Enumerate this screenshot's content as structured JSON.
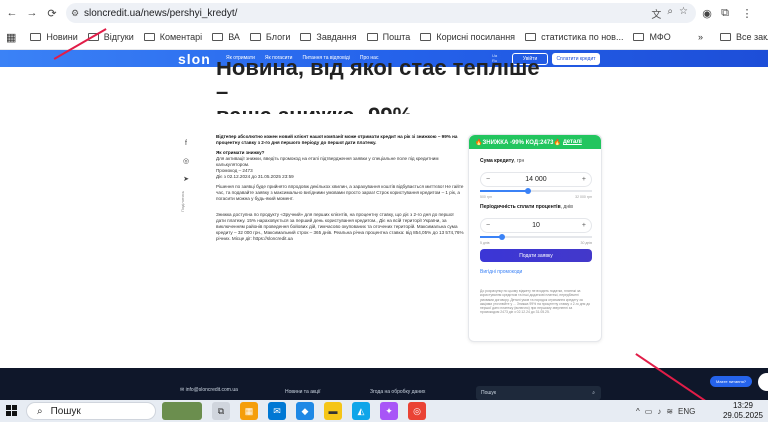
{
  "browser": {
    "url": "sloncredit.ua/news/pershyi_kredyt/",
    "bookmarks": [
      "Новини",
      "Відгуки",
      "Коментарі",
      "ВА",
      "Блоги",
      "Завдання",
      "Пошта",
      "Корисні посилання",
      "статистика по нов...",
      "МФО"
    ],
    "all_bookmarks": "Все закладки",
    "overflow": "»"
  },
  "site": {
    "logo": "slon",
    "nav": [
      "Як отримати",
      "Як погасити",
      "Питання та відповіді",
      "Про нас"
    ],
    "lang": "Ua\nRu",
    "login": "Увійти",
    "pay": "Сплатити кредит"
  },
  "article": {
    "title_line1": "Новина, від якої стає тепліше –",
    "title_line2": "ваша знижка -99%",
    "share_label": "Поділитись",
    "p1": "Відтепер абсолютно кожен новий клієнт нашої компанії може отримати кредит на рік зі знижкою – 99% на процентну ставку з 2-го дня першого періоду до першої дати платежу.",
    "q": "Як отримати знижку?",
    "p2": "Для активації знижки, введіть промокод на етапі підтвердження заявки у спеціальне поле під кредитним калькулятором.",
    "promo_line": "Промокод – 2473",
    "valid": "Діє з 02.12.2024 до 31.05.2025 23:59",
    "p3": "Рішення по заявці буде прийнято впродовж декількох хвилин, а зарахування коштів відбувається миттєво! Не гайте час, та подавайте заявку з максимально вигідними умовами просто зараз! Строк користування кредитом – 1 рік, а погасити можна у будь-який момент.",
    "p4": "Знижка доступна по продукту «Зручний» для перших клієнтів, на процентну ставку, що діє з 2-го дня до першої дати платежу. 15% нараховується за перший день користування кредитом., Діє на всій території України, за виключенням районів проведення бойових дій, тимчасово окупованих та оточених територій. Максимальна сума кредиту – 32 000 грн., Максимальний строк – 365 днів. Реальна річна процентна ставка: від 854,05% до 13 574,76% річних. Місце дії: https://sloncredit.ua"
  },
  "calculator": {
    "promo_banner": "🔥ЗНИЖКА -99% КОД:2473🔥",
    "promo_link": "деталі",
    "sum_label": "Сума кредиту",
    "sum_unit": ", грн",
    "sum_value": "14 000",
    "sum_min": "500 грн",
    "sum_max": "32 000 грн",
    "sum_fraction": 0.43,
    "period_label": "Періодичність сплати процентів",
    "period_unit": ", днів",
    "period_value": "10",
    "period_min": "5 днів",
    "period_max": "30 днів",
    "period_fraction": 0.2,
    "minus": "−",
    "plus": "+",
    "submit": "Подати заявку",
    "how_link": "Вигідні промокоди",
    "disclaimer": "До розрахунку по цьому віджету не входять податки, платежі за користування кредитом та інші додаткові платежі, передбачені умовами договору. Деталі умов та порядок отримання кредиту за акціями уточнюйте у ... Знижка 99% на процентну ставку з 2-го дня до першої дати платежу (включно) при першому зверненні за промокодом 2473 діє з 02.12.24 до 31.05.25."
  },
  "footer": {
    "email": "info@sloncredit.com.ua",
    "news": "Новини та акції",
    "consent": "Згода на обробку даних",
    "search": "Пошук"
  },
  "chat": "Маєте питання?",
  "taskbar": {
    "search": "Пошук",
    "lang": "ENG",
    "time": "13:29",
    "date": "29.05.2025"
  }
}
